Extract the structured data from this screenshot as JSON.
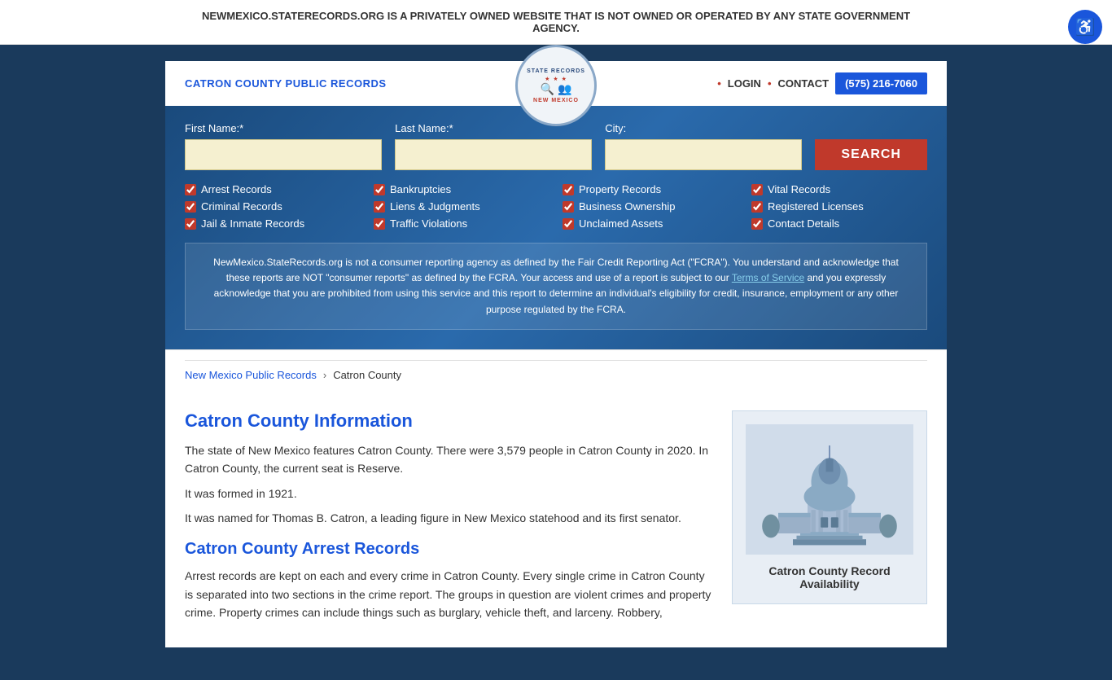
{
  "banner": {
    "text": "NEWMEXICO.STATERECORDS.ORG IS A PRIVATELY OWNED WEBSITE THAT IS NOT OWNED OR OPERATED BY ANY STATE GOVERNMENT AGENCY.",
    "close_label": "×"
  },
  "header": {
    "site_title": "CATRON COUNTY PUBLIC RECORDS",
    "logo": {
      "top_text": "STATE RECORDS",
      "stars": "★ ★ ★",
      "bottom_text": "NEW MEXICO"
    },
    "nav": {
      "login_label": "LOGIN",
      "contact_label": "CONTACT",
      "phone": "(575) 216-7060"
    }
  },
  "search": {
    "first_name_label": "First Name:*",
    "last_name_label": "Last Name:*",
    "city_label": "City:",
    "search_button": "SEARCH",
    "checkboxes": [
      {
        "label": "Arrest Records",
        "checked": true
      },
      {
        "label": "Bankruptcies",
        "checked": true
      },
      {
        "label": "Property Records",
        "checked": true
      },
      {
        "label": "Vital Records",
        "checked": true
      },
      {
        "label": "Criminal Records",
        "checked": true
      },
      {
        "label": "Liens & Judgments",
        "checked": true
      },
      {
        "label": "Business Ownership",
        "checked": true
      },
      {
        "label": "Registered Licenses",
        "checked": true
      },
      {
        "label": "Jail & Inmate Records",
        "checked": true
      },
      {
        "label": "Traffic Violations",
        "checked": true
      },
      {
        "label": "Unclaimed Assets",
        "checked": true
      },
      {
        "label": "Contact Details",
        "checked": true
      }
    ],
    "disclaimer": "NewMexico.StateRecords.org is not a consumer reporting agency as defined by the Fair Credit Reporting Act (\"FCRA\"). You understand and acknowledge that these reports are NOT \"consumer reports\" as defined by the FCRA. Your access and use of a report is subject to our Terms of Service and you expressly acknowledge that you are prohibited from using this service and this report to determine an individual's eligibility for credit, insurance, employment or any other purpose regulated by the FCRA.",
    "terms_link": "Terms of Service"
  },
  "breadcrumb": {
    "parent_label": "New Mexico Public Records",
    "separator": "›",
    "current": "Catron County"
  },
  "content": {
    "info_title": "Catron County Information",
    "info_paragraphs": [
      "The state of New Mexico features Catron County. There were 3,579 people in Catron County in 2020. In Catron County, the current seat is Reserve.",
      "It was formed in 1921.",
      "It was named for Thomas B. Catron, a leading figure in New Mexico statehood and its first senator."
    ],
    "arrest_title": "Catron County Arrest Records",
    "arrest_text": "Arrest records are kept on each and every crime in Catron County. Every single crime in Catron County is separated into two sections in the crime report. The groups in question are violent crimes and property crime. Property crimes can include things such as burglary, vehicle theft, and larceny. Robbery,",
    "sidebar_title": "Catron County Record Availability"
  },
  "accessibility": {
    "icon": "♿"
  }
}
